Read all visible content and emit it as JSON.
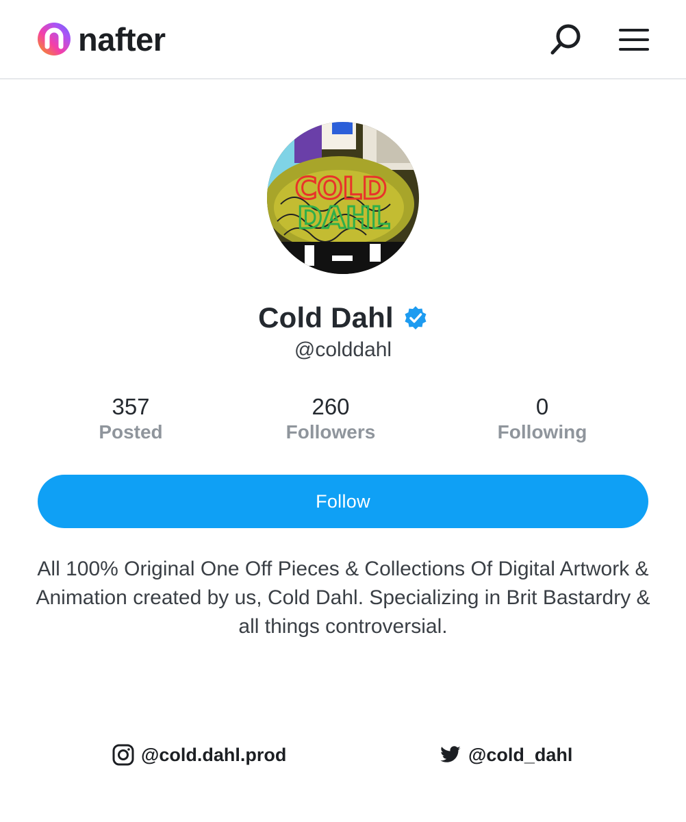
{
  "brand": {
    "name": "nafter",
    "gradient": [
      "#f43fa8",
      "#a855f7",
      "#6366f1",
      "#f59e0b"
    ]
  },
  "header": {
    "search_icon": "search-icon",
    "menu_icon": "hamburger-menu-icon"
  },
  "profile": {
    "display_name": "Cold Dahl",
    "handle": "@colddahl",
    "verified": true,
    "verified_color": "#1d9bf0",
    "avatar_text": "COLD DAHL"
  },
  "stats": [
    {
      "value": "357",
      "label": "Posted"
    },
    {
      "value": "260",
      "label": "Followers"
    },
    {
      "value": "0",
      "label": "Following"
    }
  ],
  "follow_button": {
    "label": "Follow",
    "color": "#0fa0f5"
  },
  "bio": "All 100% Original One Off Pieces & Collections Of Digital Artwork & Animation created by us, Cold Dahl. Specializing in Brit Bastardry & all things controversial.",
  "socials": [
    {
      "platform": "instagram",
      "icon": "instagram-icon",
      "handle": "@cold.dahl.prod"
    },
    {
      "platform": "twitter",
      "icon": "twitter-bird-icon",
      "handle": "@cold_dahl"
    }
  ]
}
